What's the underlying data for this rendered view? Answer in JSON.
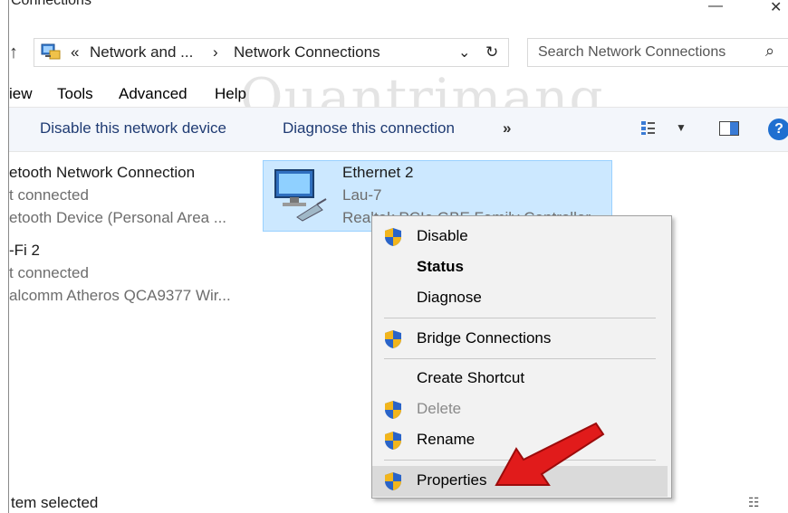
{
  "window": {
    "title": "Connections"
  },
  "address": {
    "chevron": "«",
    "crumb1": "Network and ...",
    "sep": "›",
    "crumb2": "Network Connections"
  },
  "search": {
    "placeholder": "Search Network Connections"
  },
  "menu": {
    "view": "iew",
    "tools": "Tools",
    "advanced": "Advanced",
    "help": "Help"
  },
  "commands": {
    "disable": "Disable this network device",
    "diagnose": "Diagnose this connection",
    "more": "»"
  },
  "items": [
    {
      "name": "etooth Network Connection",
      "status": "t connected",
      "device": "etooth Device (Personal Area ..."
    },
    {
      "name": "-Fi 2",
      "status": "t connected",
      "device": "alcomm Atheros QCA9377 Wir..."
    }
  ],
  "selected_item": {
    "name": "Ethernet 2",
    "status": "Lau-7",
    "device": "Realtek PCIe GBE Family Controller"
  },
  "context_menu": {
    "disable": "Disable",
    "status": "Status",
    "diagnose": "Diagnose",
    "bridge": "Bridge Connections",
    "shortcut": "Create Shortcut",
    "delete": "Delete",
    "rename": "Rename",
    "properties": "Properties"
  },
  "status_bar": {
    "text": "tem selected"
  },
  "watermark": "Quantrimang",
  "colors": {
    "accent": "#1f6fd0",
    "selection": "#cce8ff",
    "arrow": "#e11b1b"
  }
}
